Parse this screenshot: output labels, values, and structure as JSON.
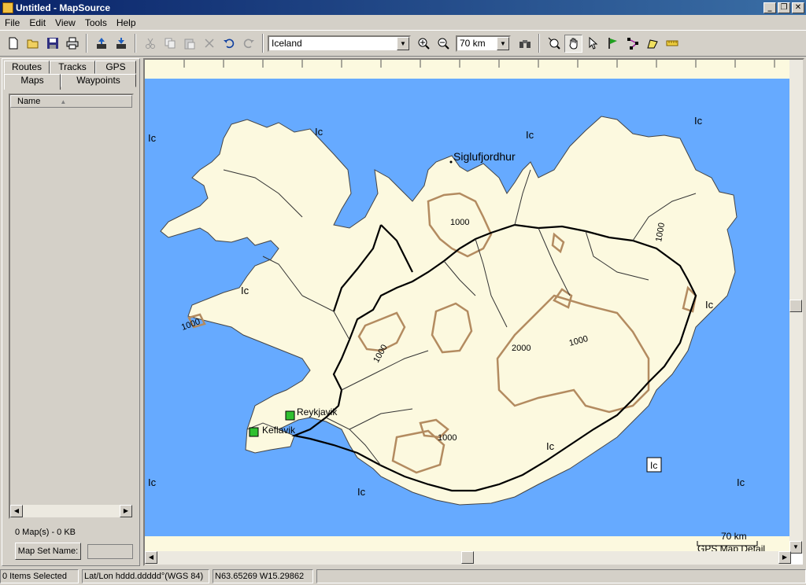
{
  "window": {
    "title": "Untitled - MapSource",
    "minimize": "_",
    "maximize": "❐",
    "close": "✕"
  },
  "menu": [
    "File",
    "Edit",
    "View",
    "Tools",
    "Help"
  ],
  "toolbar": {
    "product_combo": "Iceland",
    "zoom_combo": "70 km"
  },
  "left_panel": {
    "tabs_top": [
      "Routes",
      "Tracks",
      "GPS"
    ],
    "tabs_bottom": [
      "Maps",
      "Waypoints"
    ],
    "active_tab": "Maps",
    "list_header": "Name",
    "sort_indicator": "▲",
    "map_count": "0 Map(s) - 0 KB",
    "map_set_button": "Map Set Name:"
  },
  "map": {
    "scale_label": "70 km",
    "detail_label": "GPS Map Detail",
    "colors": {
      "water": "#66aaff",
      "land": "#fcf9df",
      "contour": "#b38b60",
      "road": "#000000",
      "boundary": "#333333"
    },
    "places": [
      {
        "name": "Siglufjordhur"
      },
      {
        "name": "Reykjavik"
      },
      {
        "name": "Keflavik"
      }
    ],
    "ice_labels": [
      "Ic",
      "Ic",
      "Ic",
      "Ic",
      "Ic",
      "Ic",
      "Ic",
      "Ic",
      "Ic",
      "Ic"
    ],
    "contour_labels": [
      "1000",
      "1000",
      "1000",
      "2000",
      "1000",
      "1000",
      "1000"
    ]
  },
  "status": {
    "selection": "0 Items Selected",
    "format": "Lat/Lon hddd.ddddd°(WGS 84)",
    "position": "N63.65269 W15.29862"
  }
}
